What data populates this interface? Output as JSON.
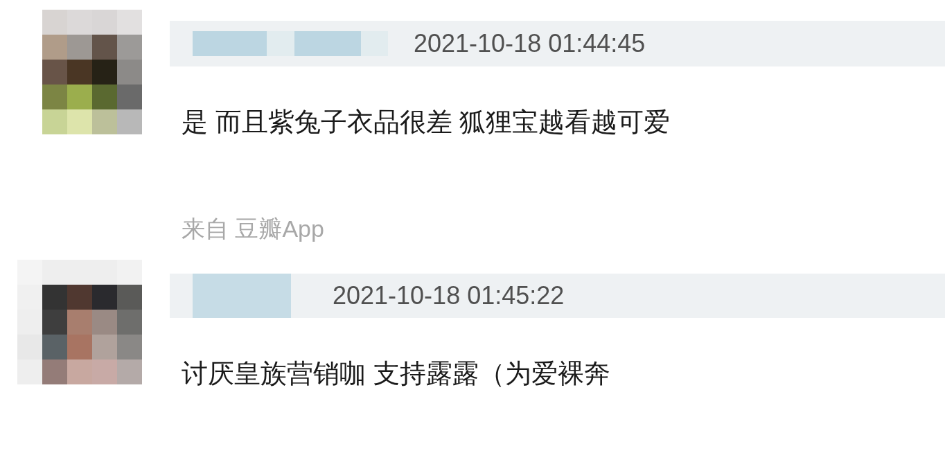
{
  "comments": [
    {
      "timestamp": "2021-10-18 01:44:45",
      "text": "是 而且紫兔子衣品很差 狐狸宝越看越可爱",
      "source": "来自 豆瓣App"
    },
    {
      "timestamp": "2021-10-18 01:45:22",
      "text": "讨厌皇族营销咖 支持露露（为爱裸奔"
    }
  ]
}
